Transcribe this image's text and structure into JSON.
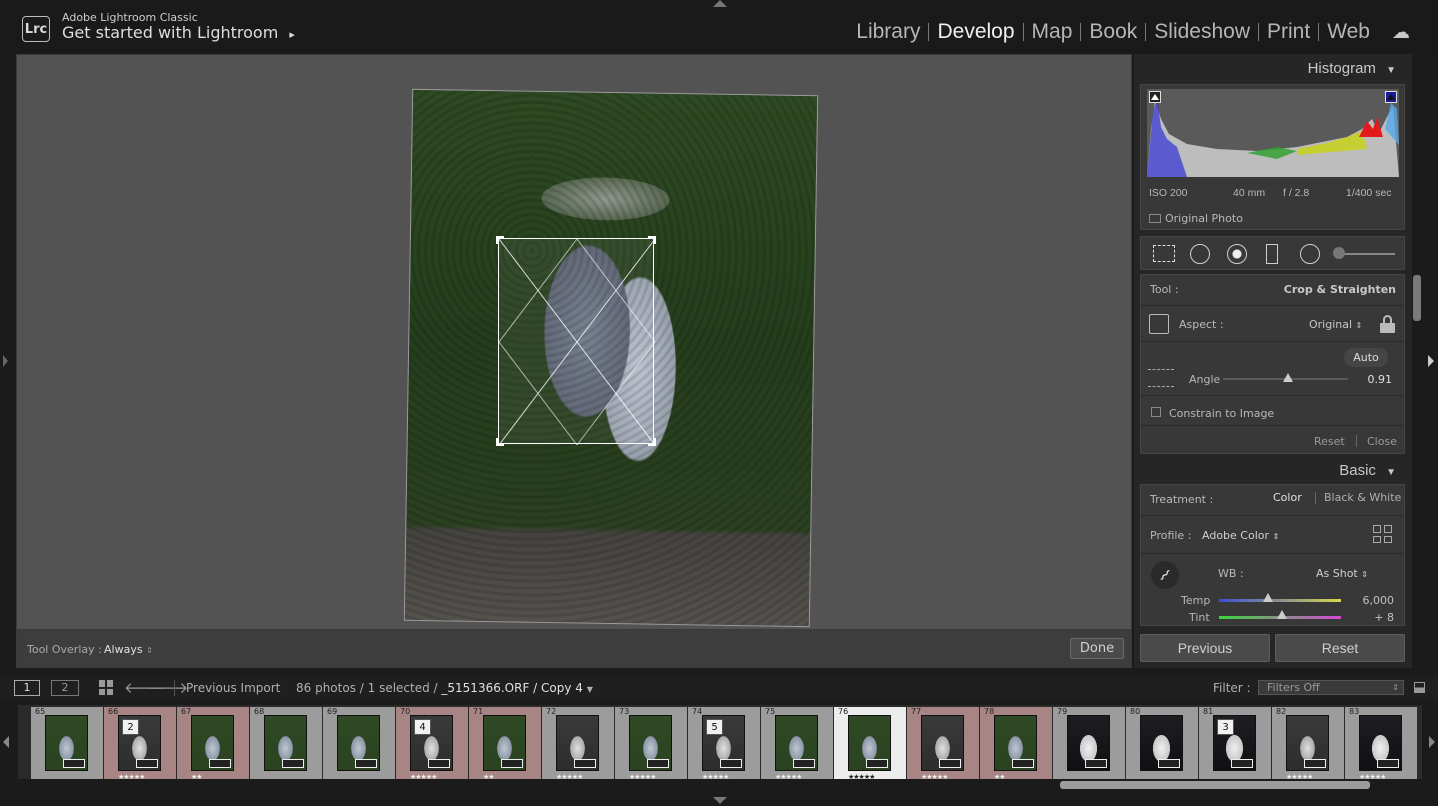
{
  "app": {
    "logo": "Lrc",
    "subtitle": "Adobe Lightroom Classic",
    "title": "Get started with Lightroom",
    "title_arrow": "▸"
  },
  "modules": [
    {
      "label": "Library",
      "active": false
    },
    {
      "label": "Develop",
      "active": true
    },
    {
      "label": "Map",
      "active": false
    },
    {
      "label": "Book",
      "active": false
    },
    {
      "label": "Slideshow",
      "active": false
    },
    {
      "label": "Print",
      "active": false
    },
    {
      "label": "Web",
      "active": false
    }
  ],
  "toolbar": {
    "overlay_label": "Tool Overlay :",
    "overlay_value": "Always",
    "done_label": "Done"
  },
  "histogram": {
    "title": "Histogram",
    "iso": "ISO 200",
    "focal": "40 mm",
    "aperture": "f / 2.8",
    "shutter": "1/400 sec",
    "original_photo": "Original Photo"
  },
  "crop": {
    "tool_label": "Tool :",
    "tool_value": "Crop & Straighten",
    "aspect_label": "Aspect :",
    "aspect_value": "Original",
    "auto_label": "Auto",
    "angle_label": "Angle",
    "angle_value": "0.91",
    "angle_fraction": 0.52,
    "constrain_label": "Constrain to Image",
    "reset_label": "Reset",
    "close_label": "Close"
  },
  "basic": {
    "title": "Basic",
    "treatment_label": "Treatment :",
    "treatment_color": "Color",
    "treatment_bw": "Black & White",
    "profile_label": "Profile :",
    "profile_value": "Adobe Color",
    "wb_label": "WB :",
    "wb_value": "As Shot",
    "temp_label": "Temp",
    "temp_value": "6,000",
    "temp_fraction": 0.4,
    "tint_label": "Tint",
    "tint_value": "+ 8",
    "tint_fraction": 0.52
  },
  "buttons": {
    "previous": "Previous",
    "reset": "Reset"
  },
  "filmbar": {
    "page1": "1",
    "page2": "2",
    "source": "Previous Import",
    "count": "86 photos / 1 selected / ",
    "filename": "_5151366.ORF / Copy 4",
    "filter_label": "Filter :",
    "filter_value": "Filters Off"
  },
  "filmstrip": [
    {
      "num": "65",
      "stars": "",
      "badge": "",
      "tone": "color",
      "bg": "#9c9c9c"
    },
    {
      "num": "66",
      "stars": "★★★★★",
      "badge": "2",
      "tone": "bw",
      "bg": "#a88585"
    },
    {
      "num": "67",
      "stars": "★★",
      "badge": "",
      "tone": "color",
      "bg": "#a88585"
    },
    {
      "num": "68",
      "stars": "",
      "badge": "",
      "tone": "color",
      "bg": "#9c9c9c"
    },
    {
      "num": "69",
      "stars": "",
      "badge": "",
      "tone": "color",
      "bg": "#9c9c9c"
    },
    {
      "num": "70",
      "stars": "★★★★★",
      "badge": "4",
      "tone": "bw",
      "bg": "#a88585"
    },
    {
      "num": "71",
      "stars": "★★",
      "badge": "",
      "tone": "color",
      "bg": "#a88585"
    },
    {
      "num": "72",
      "stars": "★★★★★",
      "badge": "",
      "tone": "bw",
      "bg": "#9c9c9c"
    },
    {
      "num": "73",
      "stars": "★★★★★",
      "badge": "",
      "tone": "color",
      "bg": "#9c9c9c"
    },
    {
      "num": "74",
      "stars": "★★★★★",
      "badge": "5",
      "tone": "bw",
      "bg": "#9c9c9c"
    },
    {
      "num": "75",
      "stars": "★★★★★",
      "badge": "",
      "tone": "color",
      "bg": "#9c9c9c"
    },
    {
      "num": "76",
      "stars": "★★★★★",
      "badge": "",
      "tone": "color",
      "bg": "#ececec"
    },
    {
      "num": "77",
      "stars": "★★★★★",
      "badge": "",
      "tone": "bw",
      "bg": "#a88585"
    },
    {
      "num": "78",
      "stars": "★★",
      "badge": "",
      "tone": "color",
      "bg": "#a88585"
    },
    {
      "num": "79",
      "stars": "",
      "badge": "",
      "tone": "dark",
      "bg": "#9c9c9c"
    },
    {
      "num": "80",
      "stars": "",
      "badge": "",
      "tone": "dark",
      "bg": "#9c9c9c"
    },
    {
      "num": "81",
      "stars": "",
      "badge": "3",
      "tone": "dark",
      "bg": "#9c9c9c"
    },
    {
      "num": "82",
      "stars": "★★★★★",
      "badge": "",
      "tone": "bw",
      "bg": "#9c9c9c"
    },
    {
      "num": "83",
      "stars": "★★★★★",
      "badge": "",
      "tone": "dark",
      "bg": "#9c9c9c"
    }
  ]
}
